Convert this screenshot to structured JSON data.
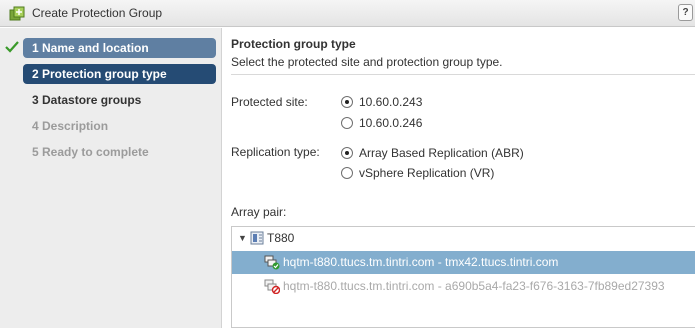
{
  "window": {
    "title": "Create Protection Group",
    "help_label": "?"
  },
  "nav": {
    "steps": [
      {
        "label": "1  Name and location",
        "state": "done"
      },
      {
        "label": "2  Protection group type",
        "state": "current"
      },
      {
        "label": "3  Datastore groups",
        "state": "next"
      },
      {
        "label": "4  Description",
        "state": "disabled"
      },
      {
        "label": "5  Ready to complete",
        "state": "disabled"
      }
    ]
  },
  "main": {
    "section_title": "Protection group type",
    "section_desc": "Select the protected site and protection group type.",
    "protected_site": {
      "label": "Protected site:",
      "options": [
        {
          "label": "10.60.0.243",
          "checked": true
        },
        {
          "label": "10.60.0.246",
          "checked": false
        }
      ]
    },
    "replication_type": {
      "label": "Replication type:",
      "options": [
        {
          "label": "Array Based Replication (ABR)",
          "checked": true
        },
        {
          "label": "vSphere Replication (VR)",
          "checked": false
        }
      ]
    },
    "array_pair": {
      "label": "Array pair:",
      "root_label": "T880",
      "rows": [
        {
          "label": "hqtm-t880.ttucs.tm.tintri.com - tmx42.ttucs.tintri.com",
          "state": "selected"
        },
        {
          "label": "hqtm-t880.ttucs.tm.tintri.com - a690b5a4-fa23-f676-3163-7fb89ed27393",
          "state": "disabled"
        }
      ]
    }
  },
  "colors": {
    "step_done_bg": "#5f7fa2",
    "step_current_bg": "#254b74",
    "selected_row_bg": "#83aece",
    "check_green": "#3a9a2a"
  },
  "icons": {
    "app": "protection-group-icon",
    "check": "check-icon",
    "tree_toggle": "expand-triangle-icon",
    "tree_root": "storage-server-icon",
    "row_ok": "array-pair-ok-icon",
    "row_blocked": "array-pair-blocked-icon"
  }
}
